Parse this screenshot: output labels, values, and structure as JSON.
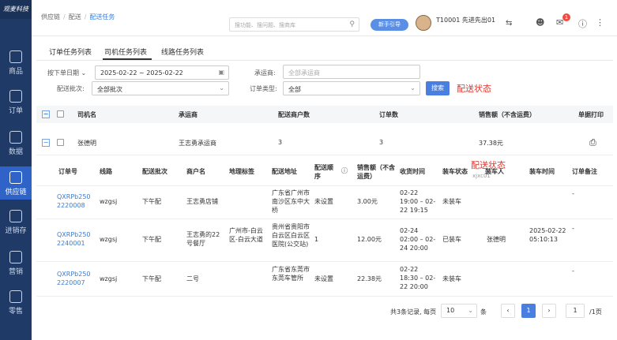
{
  "sidebar": {
    "logo": "观麦科技",
    "items": [
      {
        "label": "商品",
        "icon": "bag-icon"
      },
      {
        "label": "订单",
        "icon": "order-icon"
      },
      {
        "label": "数据",
        "icon": "chart-icon"
      },
      {
        "label": "供应链",
        "icon": "supply-chain-icon",
        "active": true
      },
      {
        "label": "进销存",
        "icon": "inventory-icon"
      },
      {
        "label": "营销",
        "icon": "marketing-icon"
      },
      {
        "label": "零售",
        "icon": "retail-icon"
      }
    ]
  },
  "header": {
    "breadcrumb": [
      "供应链",
      "配送",
      "配送任务"
    ],
    "search_placeholder": "搜功能、搜问题、搜商库",
    "guide_label": "新手引导",
    "user_name": "T10001 先进先出01",
    "user_sub": "xjxc01",
    "badge_count": "1"
  },
  "tabs": [
    "订单任务列表",
    "司机任务列表",
    "线路任务列表"
  ],
  "filters": {
    "date_label": "按下单日期",
    "date_value": "2025-02-22 ~ 2025-02-22",
    "carrier_label": "承运商:",
    "carrier_placeholder": "全部承运商",
    "batch_label": "配送批次:",
    "batch_value": "全部批次",
    "order_type_label": "订单类型:",
    "order_type_value": "全部",
    "search_button": "搜索",
    "annotation": "配送状态"
  },
  "table": {
    "headers": [
      "司机名",
      "承运商",
      "配送商户数",
      "订单数",
      "销售额（不含运费）",
      "单据打印"
    ],
    "row": {
      "driver": "张德明",
      "carrier": "王志勇承运商",
      "merchants": "3",
      "orders": "3",
      "sales": "37.38元"
    }
  },
  "subtable": {
    "annotation": "配送状态",
    "headers": [
      "订单号",
      "线路",
      "配送批次",
      "商户名",
      "地理标签",
      "配送地址",
      "配送顺序",
      "销售额（不含运费）",
      "收货时间",
      "装车状态",
      "装车人",
      "装车时间",
      "订单备注"
    ],
    "rows": [
      {
        "order_no": "QXRPb2502220008",
        "route": "wzgsj",
        "batch": "下午配",
        "merchant": "王志勇店铺",
        "geo": "",
        "address": "广东省广州市南沙区东中大桥",
        "seq": "未设置",
        "sales": "3.00元",
        "receive_time": "02-22 19:00 – 02-22 19:15",
        "load_status": "未装车",
        "loader": "",
        "load_time": "",
        "remark": "-"
      },
      {
        "order_no": "QXRPb2502240001",
        "route": "wzgsj",
        "batch": "下午配",
        "merchant": "王志勇的22号餐厅",
        "geo": "广州市-白云区-白云大道",
        "address": "贵州省贵阳市白云区白云区医院(公交站)",
        "seq": "1",
        "sales": "12.00元",
        "receive_time": "02-24 02:00 – 02-24 20:00",
        "load_status": "已装车",
        "loader": "张德明",
        "load_time": "2025-02-22 05:10:13",
        "remark": "-"
      },
      {
        "order_no": "QXRPb2502220007",
        "route": "wzgsj",
        "batch": "下午配",
        "merchant": "二号",
        "geo": "",
        "address": "广东省东莞市东莞车管所",
        "seq": "未设置",
        "sales": "22.38元",
        "receive_time": "02-22 18:30 – 02-22 20:00",
        "load_status": "未装车",
        "loader": "",
        "load_time": "",
        "remark": "-"
      }
    ]
  },
  "pagination": {
    "summary": "共3条记录, 每页",
    "page_size": "10",
    "unit": "条",
    "current": "1",
    "jump_value": "1",
    "total_pages": "/1页"
  }
}
